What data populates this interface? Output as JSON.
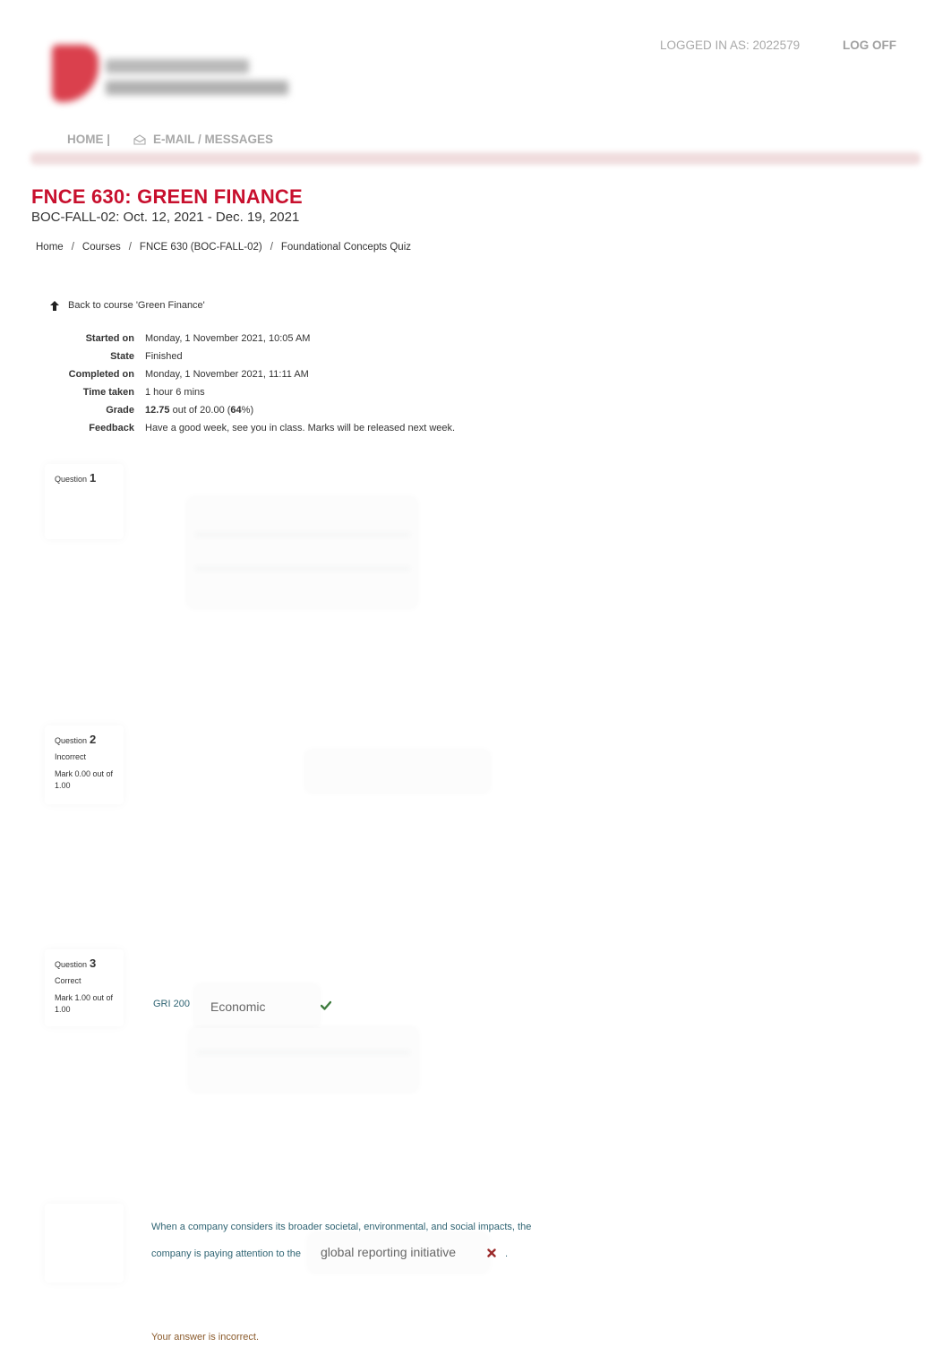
{
  "header": {
    "logo_alt": "University logo (blurred)",
    "logged_in_label": "LOGGED IN AS: 2022579",
    "logoff_label": "LOG OFF",
    "nav": {
      "home_label": "HOME |",
      "mail_icon": "envelope-open-icon",
      "mail_label": "E-MAIL / MESSAGES"
    },
    "accent_color": "#c8102e"
  },
  "course": {
    "title": "FNCE 630: GREEN FINANCE",
    "dates": "BOC-FALL-02: Oct. 12, 2021 - Dec. 19, 2021"
  },
  "breadcrumb": {
    "separator": "/",
    "items": [
      "Home",
      "Courses",
      "FNCE 630 (BOC-FALL-02)",
      "Foundational Concepts Quiz"
    ]
  },
  "back_link": {
    "icon": "arrow-up-icon",
    "label": "Back to course 'Green Finance'"
  },
  "summary": {
    "rows": [
      {
        "label": "Started on",
        "value": "Monday, 1 November 2021, 10:05 AM"
      },
      {
        "label": "State",
        "value": "Finished"
      },
      {
        "label": "Completed on",
        "value": "Monday, 1 November 2021, 11:11 AM"
      },
      {
        "label": "Time taken",
        "value": "1 hour 6 mins"
      },
      {
        "label": "Grade",
        "value_bold": "12.75",
        "value_mid": " out of 20.00 (",
        "value_pct": "64",
        "value_end": "%)"
      },
      {
        "label": "Feedback",
        "value": "Have a good week, see you in class. Marks will be released next week."
      }
    ]
  },
  "questions": [
    {
      "prefix": "Question",
      "number": "1"
    },
    {
      "prefix": "Question",
      "number": "2",
      "state": "Incorrect",
      "mark": "Mark 0.00 out of 1.00"
    },
    {
      "prefix": "Question",
      "number": "3",
      "state": "Correct",
      "mark": "Mark 1.00 out of 1.00",
      "item_label": "GRI 200",
      "answer": "Economic",
      "result_icon": "check-icon",
      "result_color": "#3f7c3f"
    },
    {
      "text_line1": "When a company considers its broader societal, environmental, and social impacts, the",
      "text_line2": "company is paying attention to the",
      "answer": "global reporting initiative",
      "result_icon": "x-icon",
      "result_color": "#9b2a2a",
      "trailing": ".",
      "feedback": "Your answer is incorrect."
    }
  ]
}
